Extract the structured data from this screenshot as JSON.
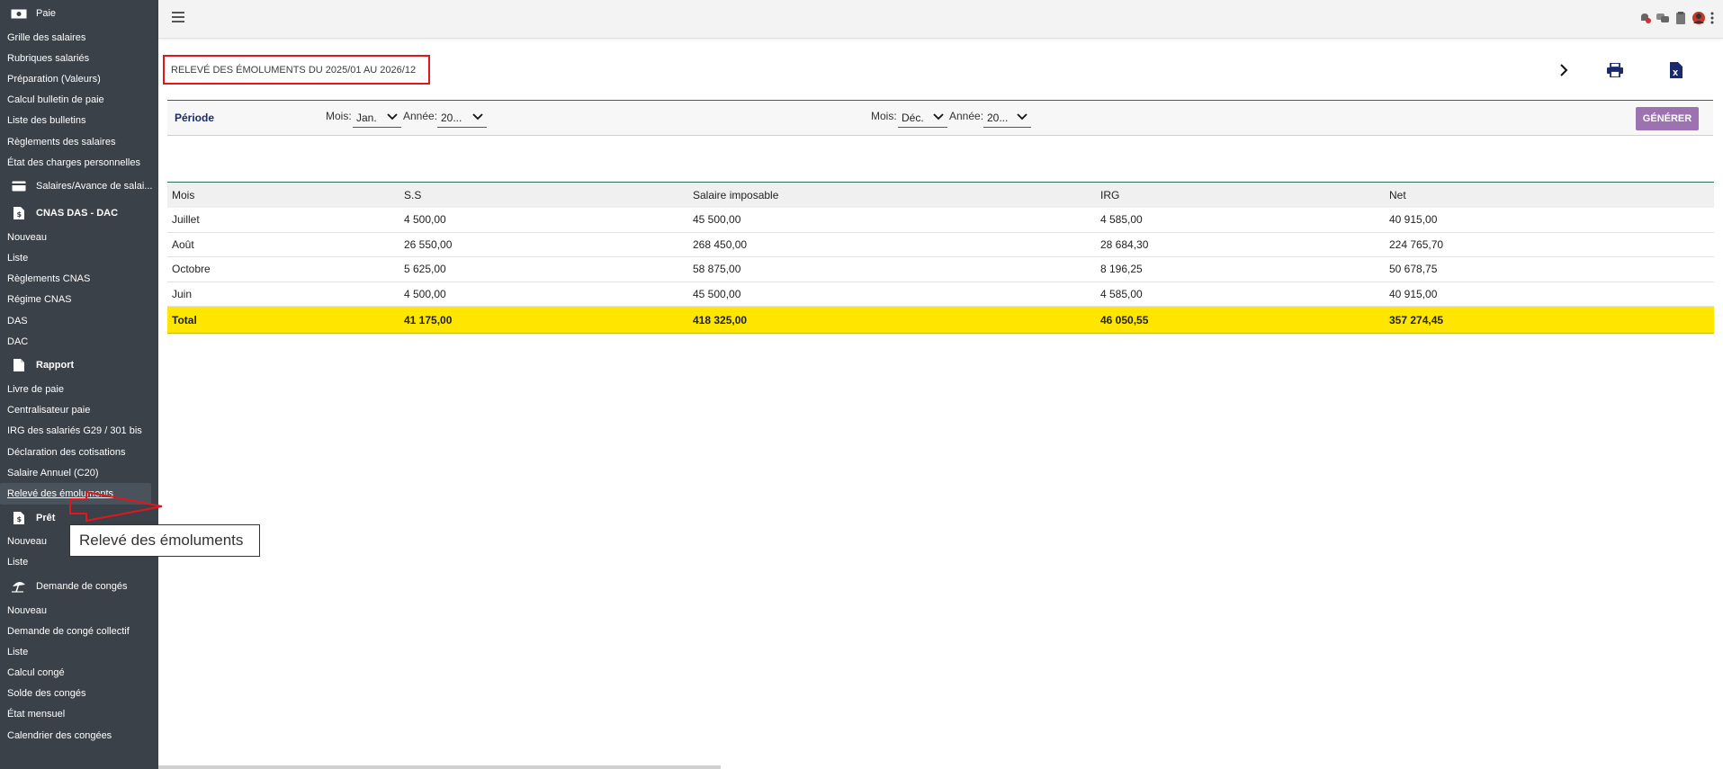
{
  "sidebar": {
    "paie": {
      "title": "Paie",
      "items": [
        "Grille des salaires",
        "Rubriques salariés",
        "Préparation (Valeurs)",
        "Calcul bulletin de paie",
        "Liste des bulletins",
        "Règlements des salaires",
        "État des charges personnelles"
      ]
    },
    "salaires_avance": {
      "title": "Salaires/Avance de salai..."
    },
    "cnas": {
      "title": "CNAS DAS - DAC",
      "items": [
        "Nouveau",
        "Liste",
        "Règlements CNAS",
        "Régime CNAS",
        "DAS",
        "DAC"
      ]
    },
    "rapport": {
      "title": "Rapport",
      "items": [
        "Livre de paie",
        "Centralisateur paie",
        "IRG des salariés G29 / 301 bis",
        "Déclaration des cotisations",
        "Salaire Annuel (C20)",
        "Relevé des émoluments"
      ]
    },
    "pret": {
      "title": "Prêt",
      "items": [
        "Nouveau",
        "Liste"
      ]
    },
    "conges": {
      "title": "Demande de congés",
      "items": [
        "Nouveau",
        "Demande de congé collectif",
        "Liste",
        "Calcul congé",
        "Solde des congés",
        "État mensuel",
        "Calendrier des congées"
      ]
    }
  },
  "header": {
    "page_title": "RELEVÉ DES ÉMOLUMENTS DU 2025/01 AU 2026/12"
  },
  "period": {
    "label": "Période",
    "from": {
      "mois_label": "Mois:",
      "mois_value": "Jan.",
      "annee_label": "Année:",
      "annee_value": "20..."
    },
    "to": {
      "mois_label": "Mois:",
      "mois_value": "Déc.",
      "annee_label": "Année:",
      "annee_value": "20..."
    },
    "generate_label": "GÉNÉRER"
  },
  "table": {
    "columns": [
      "Mois",
      "S.S",
      "Salaire imposable",
      "IRG",
      "Net"
    ],
    "rows": [
      [
        "Juillet",
        "4 500,00",
        "45 500,00",
        "4 585,00",
        "40 915,00"
      ],
      [
        "Août",
        "26 550,00",
        "268 450,00",
        "28 684,30",
        "224 765,70"
      ],
      [
        "Octobre",
        "5 625,00",
        "58 875,00",
        "8 196,25",
        "50 678,75"
      ],
      [
        "Juin",
        "4 500,00",
        "45 500,00",
        "4 585,00",
        "40 915,00"
      ]
    ],
    "total": [
      "Total",
      "41 175,00",
      "418 325,00",
      "46 050,55",
      "357 274,45"
    ]
  },
  "tooltip": {
    "text": "Relevé des émoluments"
  },
  "colors": {
    "sidebar_bg": "#3a4149",
    "total_row": "#ffe600",
    "generate_btn": "#9c72b0",
    "annotation": "#e3161b"
  }
}
